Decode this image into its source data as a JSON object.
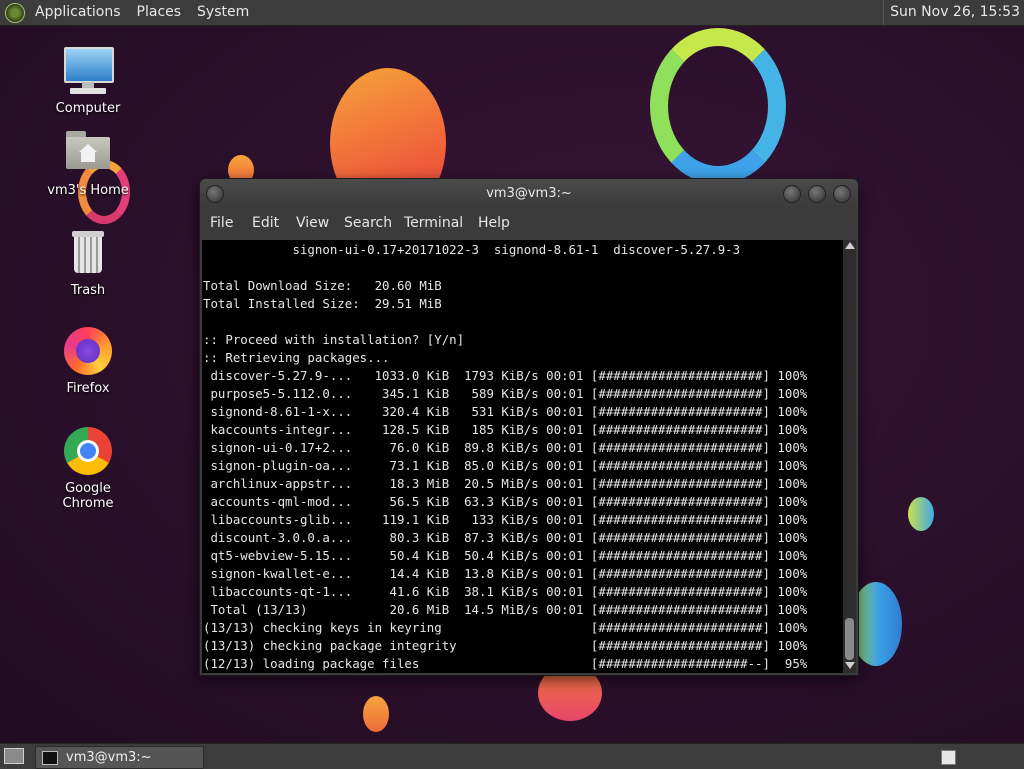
{
  "top_panel": {
    "menus": [
      "Applications",
      "Places",
      "System"
    ],
    "clock": "Sun Nov 26, 15:53"
  },
  "desktop_icons": [
    {
      "label": "Computer",
      "icon": "computer-icon"
    },
    {
      "label": "vm3's Home",
      "icon": "home-folder-icon"
    },
    {
      "label": "Trash",
      "icon": "trash-icon"
    },
    {
      "label": "Firefox",
      "icon": "firefox-icon"
    },
    {
      "label": "Google Chrome",
      "icon": "chrome-icon"
    }
  ],
  "window": {
    "title": "vm3@vm3:~",
    "menu": [
      "File",
      "Edit",
      "View",
      "Search",
      "Terminal",
      "Help"
    ]
  },
  "terminal_lines": [
    "            signon-ui-0.17+20171022-3  signond-8.61-1  discover-5.27.9-3",
    "",
    "Total Download Size:   20.60 MiB",
    "Total Installed Size:  29.51 MiB",
    "",
    ":: Proceed with installation? [Y/n]",
    ":: Retrieving packages...",
    " discover-5.27.9-...   1033.0 KiB  1793 KiB/s 00:01 [######################] 100%",
    " purpose5-5.112.0...    345.1 KiB   589 KiB/s 00:01 [######################] 100%",
    " signond-8.61-1-x...    320.4 KiB   531 KiB/s 00:01 [######################] 100%",
    " kaccounts-integr...    128.5 KiB   185 KiB/s 00:01 [######################] 100%",
    " signon-ui-0.17+2...     76.0 KiB  89.8 KiB/s 00:01 [######################] 100%",
    " signon-plugin-oa...     73.1 KiB  85.0 KiB/s 00:01 [######################] 100%",
    " archlinux-appstr...     18.3 MiB  20.5 MiB/s 00:01 [######################] 100%",
    " accounts-qml-mod...     56.5 KiB  63.3 KiB/s 00:01 [######################] 100%",
    " libaccounts-glib...    119.1 KiB   133 KiB/s 00:01 [######################] 100%",
    " discount-3.0.0.a...     80.3 KiB  87.3 KiB/s 00:01 [######################] 100%",
    " qt5-webview-5.15...     50.4 KiB  50.4 KiB/s 00:01 [######################] 100%",
    " signon-kwallet-e...     14.4 KiB  13.8 KiB/s 00:01 [######################] 100%",
    " libaccounts-qt-1...     41.6 KiB  38.1 KiB/s 00:01 [######################] 100%",
    " Total (13/13)           20.6 MiB  14.5 MiB/s 00:01 [######################] 100%",
    "(13/13) checking keys in keyring                    [######################] 100%",
    "(13/13) checking package integrity                  [######################] 100%",
    "(12/13) loading package files                       [####################--]  95%"
  ],
  "taskbar": {
    "task_label": "vm3@vm3:~"
  }
}
